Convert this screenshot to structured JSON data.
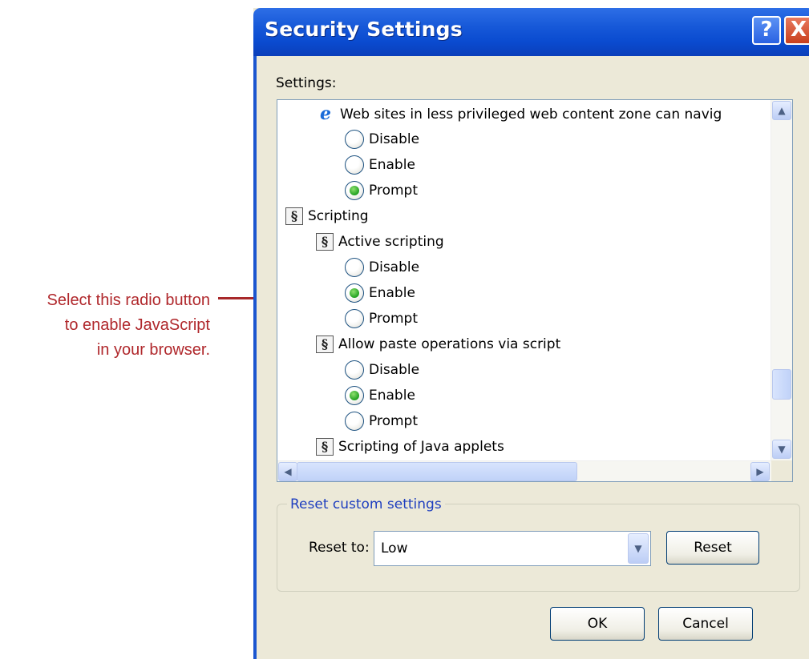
{
  "annotation": {
    "lines": [
      "Select this radio button",
      "to enable JavaScript",
      "in your browser."
    ]
  },
  "dialog": {
    "title": "Security Settings",
    "help_label": "?",
    "close_label": "X",
    "settings_label": "Settings:",
    "items": [
      {
        "kind": "setting",
        "icon": "ie-icon",
        "label": "Web sites in less privileged web content zone can navig"
      },
      {
        "kind": "radio",
        "label": "Disable",
        "checked": false
      },
      {
        "kind": "radio",
        "label": "Enable",
        "checked": false
      },
      {
        "kind": "radio",
        "label": "Prompt",
        "checked": true
      },
      {
        "kind": "category",
        "icon": "script-icon",
        "label": "Scripting"
      },
      {
        "kind": "setting",
        "icon": "script-icon",
        "label": "Active scripting"
      },
      {
        "kind": "radio",
        "label": "Disable",
        "checked": false
      },
      {
        "kind": "radio",
        "label": "Enable",
        "checked": true
      },
      {
        "kind": "radio",
        "label": "Prompt",
        "checked": false
      },
      {
        "kind": "setting",
        "icon": "script-icon",
        "label": "Allow paste operations via script"
      },
      {
        "kind": "radio",
        "label": "Disable",
        "checked": false
      },
      {
        "kind": "radio",
        "label": "Enable",
        "checked": true
      },
      {
        "kind": "radio",
        "label": "Prompt",
        "checked": false
      },
      {
        "kind": "setting",
        "icon": "script-icon",
        "label": "Scripting of Java applets"
      }
    ],
    "reset_group": {
      "title": "Reset custom settings",
      "reset_to_label": "Reset to:",
      "selected": "Low",
      "reset_button": "Reset"
    },
    "ok_button": "OK",
    "cancel_button": "Cancel"
  },
  "colors": {
    "title_bar": "#0a4bd0",
    "annotation": "#b0282c",
    "radio_selected": "#21a121"
  }
}
